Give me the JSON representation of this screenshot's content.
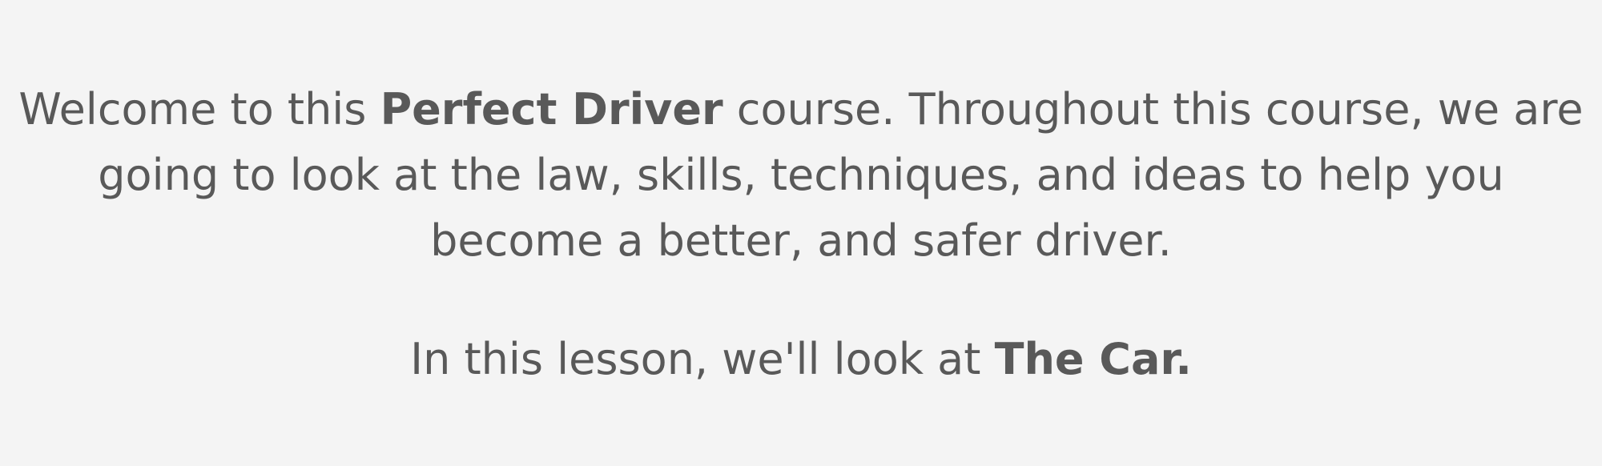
{
  "intro": {
    "part1": "Welcome to this ",
    "bold": "Perfect Driver",
    "part2": " course. Throughout this course, we are going to look at the law, skills, techniques, and ideas to help you become a better, and safer driver."
  },
  "lesson": {
    "part1": "In this lesson, we'll look at ",
    "bold": "The Car."
  },
  "colors": {
    "background": "#f4f4f4",
    "text": "#595959"
  }
}
